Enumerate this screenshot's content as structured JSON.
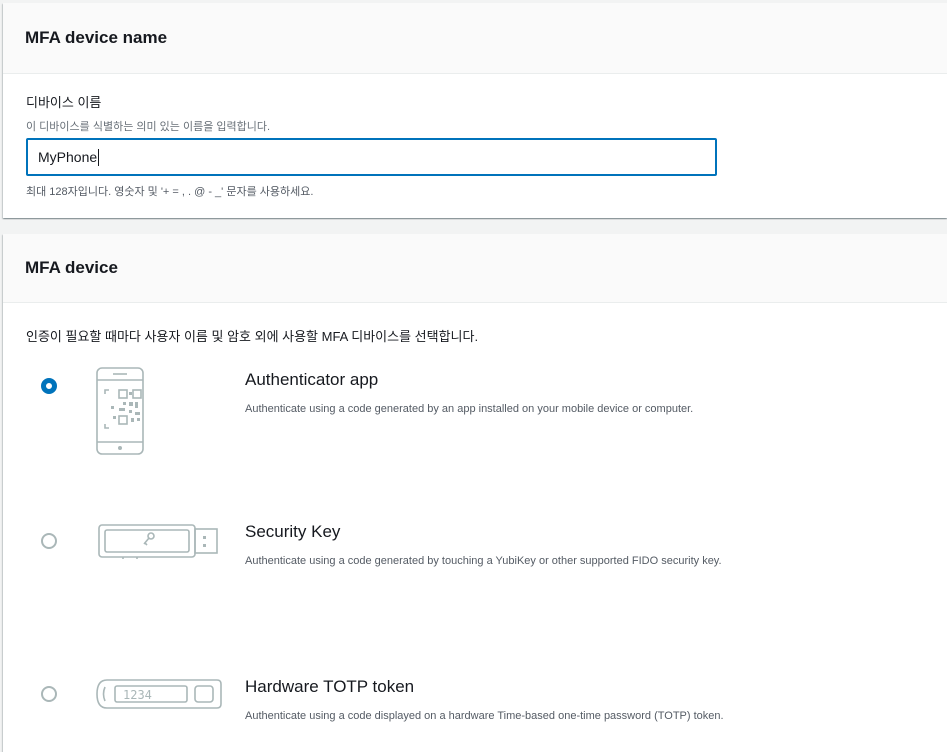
{
  "name_panel": {
    "title": "MFA device name",
    "field_label": "디바이스 이름",
    "field_description": "이 디바이스를 식별하는 의미 있는 이름을 입력합니다.",
    "input_value": "MyPhone",
    "constraint": "최대 128자입니다. 영숫자 및 '+ = , . @ - _' 문자를 사용하세요."
  },
  "device_panel": {
    "title": "MFA device",
    "description": "인증이 필요할 때마다 사용자 이름 및 암호 외에 사용할 MFA 디바이스를 선택합니다.",
    "options": [
      {
        "title": "Authenticator app",
        "description": "Authenticate using a code generated by an app installed on your mobile device or computer.",
        "selected": true,
        "icon": "phone-qr-icon"
      },
      {
        "title": "Security Key",
        "description": "Authenticate using a code generated by touching a YubiKey or other supported FIDO security key.",
        "selected": false,
        "icon": "security-key-icon"
      },
      {
        "title": "Hardware TOTP token",
        "description": "Authenticate using a code displayed on a hardware Time-based one-time password (TOTP) token.",
        "selected": false,
        "icon": "totp-token-icon",
        "token_display": "1234"
      }
    ]
  },
  "colors": {
    "accent": "#0073bb",
    "icon_gray": "#aab7b8",
    "text": "#16191f",
    "muted": "#687078"
  }
}
